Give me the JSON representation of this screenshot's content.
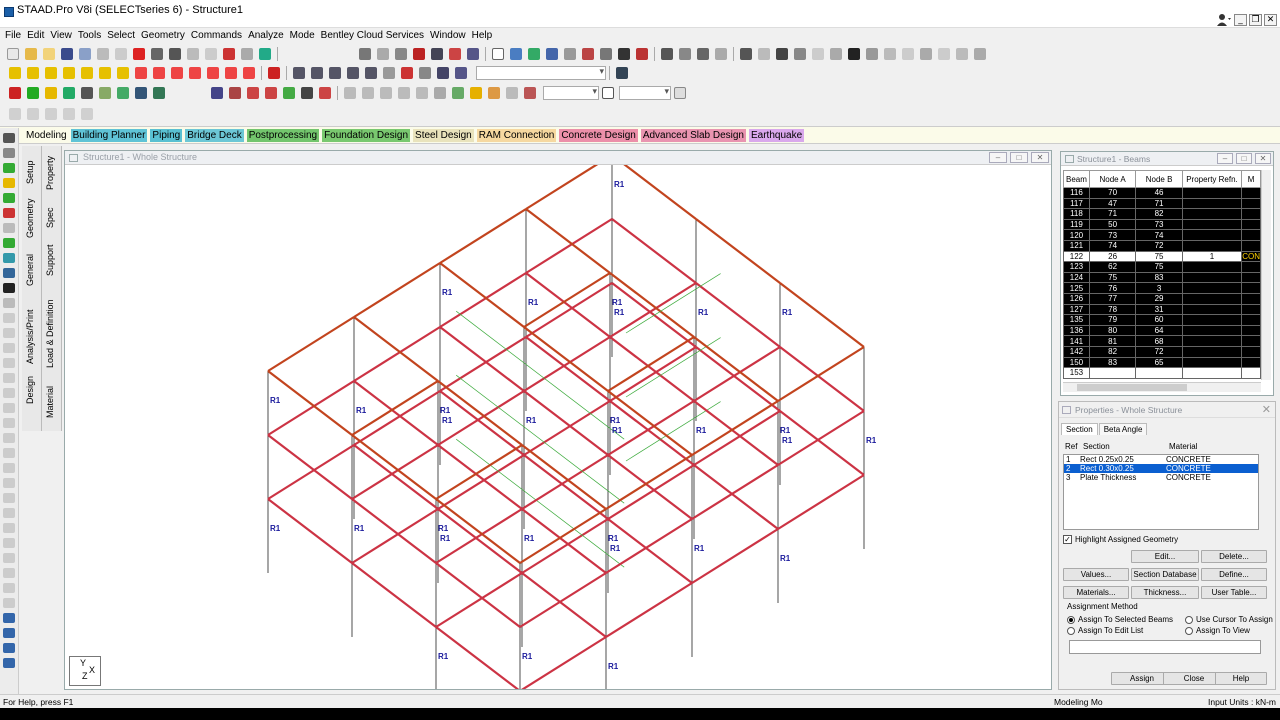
{
  "app": {
    "title": "STAAD.Pro V8i (SELECTseries 6) - Structure1"
  },
  "menu": [
    "File",
    "Edit",
    "View",
    "Tools",
    "Select",
    "Geometry",
    "Commands",
    "Analyze",
    "Mode",
    "Bentley Cloud Services",
    "Window",
    "Help"
  ],
  "page_control": {
    "mode": "Modeling",
    "tabs": [
      {
        "label": "Building Planner",
        "color": "#5fc3d6"
      },
      {
        "label": "Piping",
        "color": "#59c0d2"
      },
      {
        "label": "Bridge Deck",
        "color": "#6cc7d6"
      },
      {
        "label": "Postprocessing",
        "color": "#73c56d"
      },
      {
        "label": "Foundation Design",
        "color": "#79c86f"
      },
      {
        "label": "Steel Design",
        "color": "#e9e3bc"
      },
      {
        "label": "RAM Connection",
        "color": "#f6d8a0"
      },
      {
        "label": "Concrete Design",
        "color": "#ec8fa9"
      },
      {
        "label": "Advanced Slab Design",
        "color": "#e994b0"
      },
      {
        "label": "Earthquake",
        "color": "#d9a8ec"
      }
    ]
  },
  "side_tabs": {
    "group1": [
      "Setup",
      "Geometry",
      "General",
      "Analysis/Print",
      "Design"
    ],
    "group2": [
      "Property",
      "Spec",
      "Support",
      "Load & Definition",
      "Material"
    ]
  },
  "viewport": {
    "title": "Structure1 - Whole Structure",
    "member_label": "R1",
    "axis_x": "X",
    "axis_y": "Y",
    "axis_z": "Z"
  },
  "beam_table": {
    "title": "Structure1 - Beams",
    "columns": [
      "Beam",
      "Node A",
      "Node B",
      "Property Refn.",
      "M"
    ],
    "rows": [
      [
        "116",
        "70",
        "46",
        "",
        ""
      ],
      [
        "117",
        "47",
        "71",
        "",
        ""
      ],
      [
        "118",
        "71",
        "82",
        "",
        ""
      ],
      [
        "119",
        "50",
        "73",
        "",
        ""
      ],
      [
        "120",
        "73",
        "74",
        "",
        ""
      ],
      [
        "121",
        "74",
        "72",
        "",
        ""
      ],
      [
        "122",
        "26",
        "75",
        "1",
        "CON"
      ],
      [
        "123",
        "62",
        "75",
        "",
        ""
      ],
      [
        "124",
        "75",
        "83",
        "",
        ""
      ],
      [
        "125",
        "76",
        "3",
        "",
        ""
      ],
      [
        "126",
        "77",
        "29",
        "",
        ""
      ],
      [
        "127",
        "78",
        "31",
        "",
        ""
      ],
      [
        "135",
        "79",
        "60",
        "",
        ""
      ],
      [
        "136",
        "80",
        "64",
        "",
        ""
      ],
      [
        "141",
        "81",
        "68",
        "",
        ""
      ],
      [
        "142",
        "82",
        "72",
        "",
        ""
      ],
      [
        "150",
        "83",
        "65",
        "",
        ""
      ],
      [
        "153",
        "",
        "",
        "",
        ""
      ]
    ],
    "selected_row": 6
  },
  "properties": {
    "title": "Properties - Whole Structure",
    "tabs": [
      "Section",
      "Beta Angle"
    ],
    "headers": {
      "ref": "Ref",
      "section": "Section",
      "material": "Material"
    },
    "rows": [
      {
        "ref": "1",
        "section": "Rect 0.25x0.25",
        "material": "CONCRETE"
      },
      {
        "ref": "2",
        "section": "Rect 0.30x0.25",
        "material": "CONCRETE"
      },
      {
        "ref": "3",
        "section": "Plate Thickness",
        "material": "CONCRETE"
      }
    ],
    "selected_row": 1,
    "highlight_label": "Highlight Assigned Geometry",
    "buttons": {
      "edit": "Edit...",
      "delete": "Delete...",
      "values": "Values...",
      "section_database": "Section Database",
      "define": "Define...",
      "materials": "Materials...",
      "thickness": "Thickness...",
      "user_table": "User Table...",
      "assign": "Assign",
      "close": "Close",
      "help": "Help"
    },
    "assignment_method": "Assignment Method",
    "radios": {
      "selected_beams": "Assign To Selected Beams",
      "cursor": "Use Cursor To Assign",
      "edit_list": "Assign To Edit List",
      "view": "Assign To View"
    }
  },
  "status": {
    "help": "For Help, press F1",
    "mode": "Modeling Mo",
    "units": "Input Units : kN-m"
  }
}
